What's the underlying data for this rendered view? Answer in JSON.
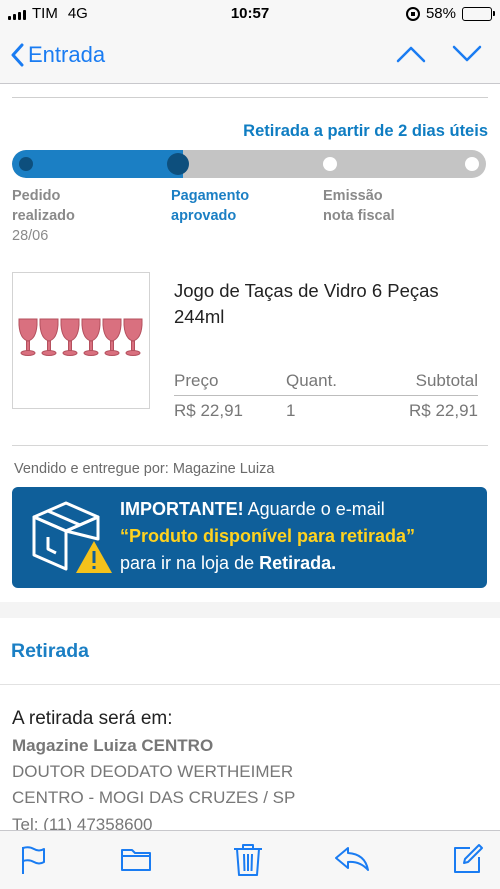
{
  "status_bar": {
    "carrier": "TIM",
    "network": "4G",
    "time": "10:57",
    "battery": "58%",
    "battery_level": 0.58
  },
  "nav": {
    "back_label": "Entrada",
    "back_icon": "chevron-left-icon",
    "up_icon": "chevron-up-icon",
    "down_icon": "chevron-down-icon"
  },
  "order": {
    "retirada_note": "Retirada a partir de 2 dias úteis",
    "progress_fraction": 0.36,
    "steps": [
      {
        "line1": "Pedido",
        "line2": "realizado",
        "date": "28/06",
        "state": "done"
      },
      {
        "line1": "Pagamento",
        "line2": "aprovado",
        "date": "",
        "state": "current"
      },
      {
        "line1": "Emissão",
        "line2": "nota fiscal",
        "date": "",
        "state": "pending"
      }
    ]
  },
  "product": {
    "name": "Jogo de Taças de Vidro 6 Peças 244ml",
    "image_icon": "pink-glasses-product-image",
    "table": {
      "headers": [
        "Preço",
        "Quant.",
        "Subtotal"
      ],
      "values": [
        "R$ 22,91",
        "1",
        "R$ 22,91"
      ]
    }
  },
  "vendor": "Vendido e entregue por: Magazine Luiza",
  "banner": {
    "important": "IMPORTANTE!",
    "text1": " Aguarde o e-mail",
    "highlight": "“Produto disponível para retirada”",
    "text2": "para ir na loja de ",
    "store_word": "Retirada.",
    "icon": "box-warning-icon"
  },
  "pickup": {
    "section_title": "Retirada",
    "intro": "A retirada será em:",
    "store": "Magazine Luiza CENTRO",
    "address1": "DOUTOR DEODATO WERTHEIMER",
    "address2": "CENTRO - MOGI DAS CRUZES / SP",
    "phone": "Tel: (11) 47358600"
  },
  "toolbar": {
    "icons": [
      "flag-icon",
      "folder-icon",
      "trash-icon",
      "reply-icon",
      "compose-icon"
    ]
  },
  "colors": {
    "accent": "#1b7fc4",
    "ios_blue": "#1a7cf2",
    "banner": "#0f5f9a",
    "banner_highlight": "#ffd21f",
    "progress_track": "#c4c4c4",
    "progress_done_dot": "#0d4f7d"
  }
}
